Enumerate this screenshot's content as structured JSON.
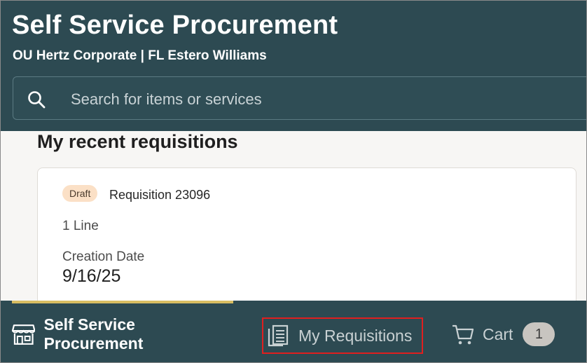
{
  "header": {
    "title": "Self Service Procurement",
    "org_line": "OU Hertz Corporate | FL Estero Williams",
    "search": {
      "placeholder": "Search for items or services",
      "icon": "search-icon"
    }
  },
  "recent": {
    "section_title": "My recent requisitions",
    "card": {
      "status": "Draft",
      "name": "Requisition 23096",
      "lines": "1 Line",
      "date_label": "Creation Date",
      "date_value": "9/16/25"
    }
  },
  "bottom_nav": {
    "items": [
      {
        "label": "Self Service Procurement",
        "icon": "storefront-icon",
        "active": true
      },
      {
        "label": "My Requisitions",
        "icon": "requisitions-list-icon",
        "active": false
      },
      {
        "label": "Cart",
        "icon": "cart-icon",
        "active": false,
        "badge": "1"
      }
    ]
  },
  "colors": {
    "header_bg": "#2d4a52",
    "active_indicator": "#d8bd62",
    "draft_badge_bg": "#fbe0c6",
    "highlight_box": "#e01f1f"
  }
}
